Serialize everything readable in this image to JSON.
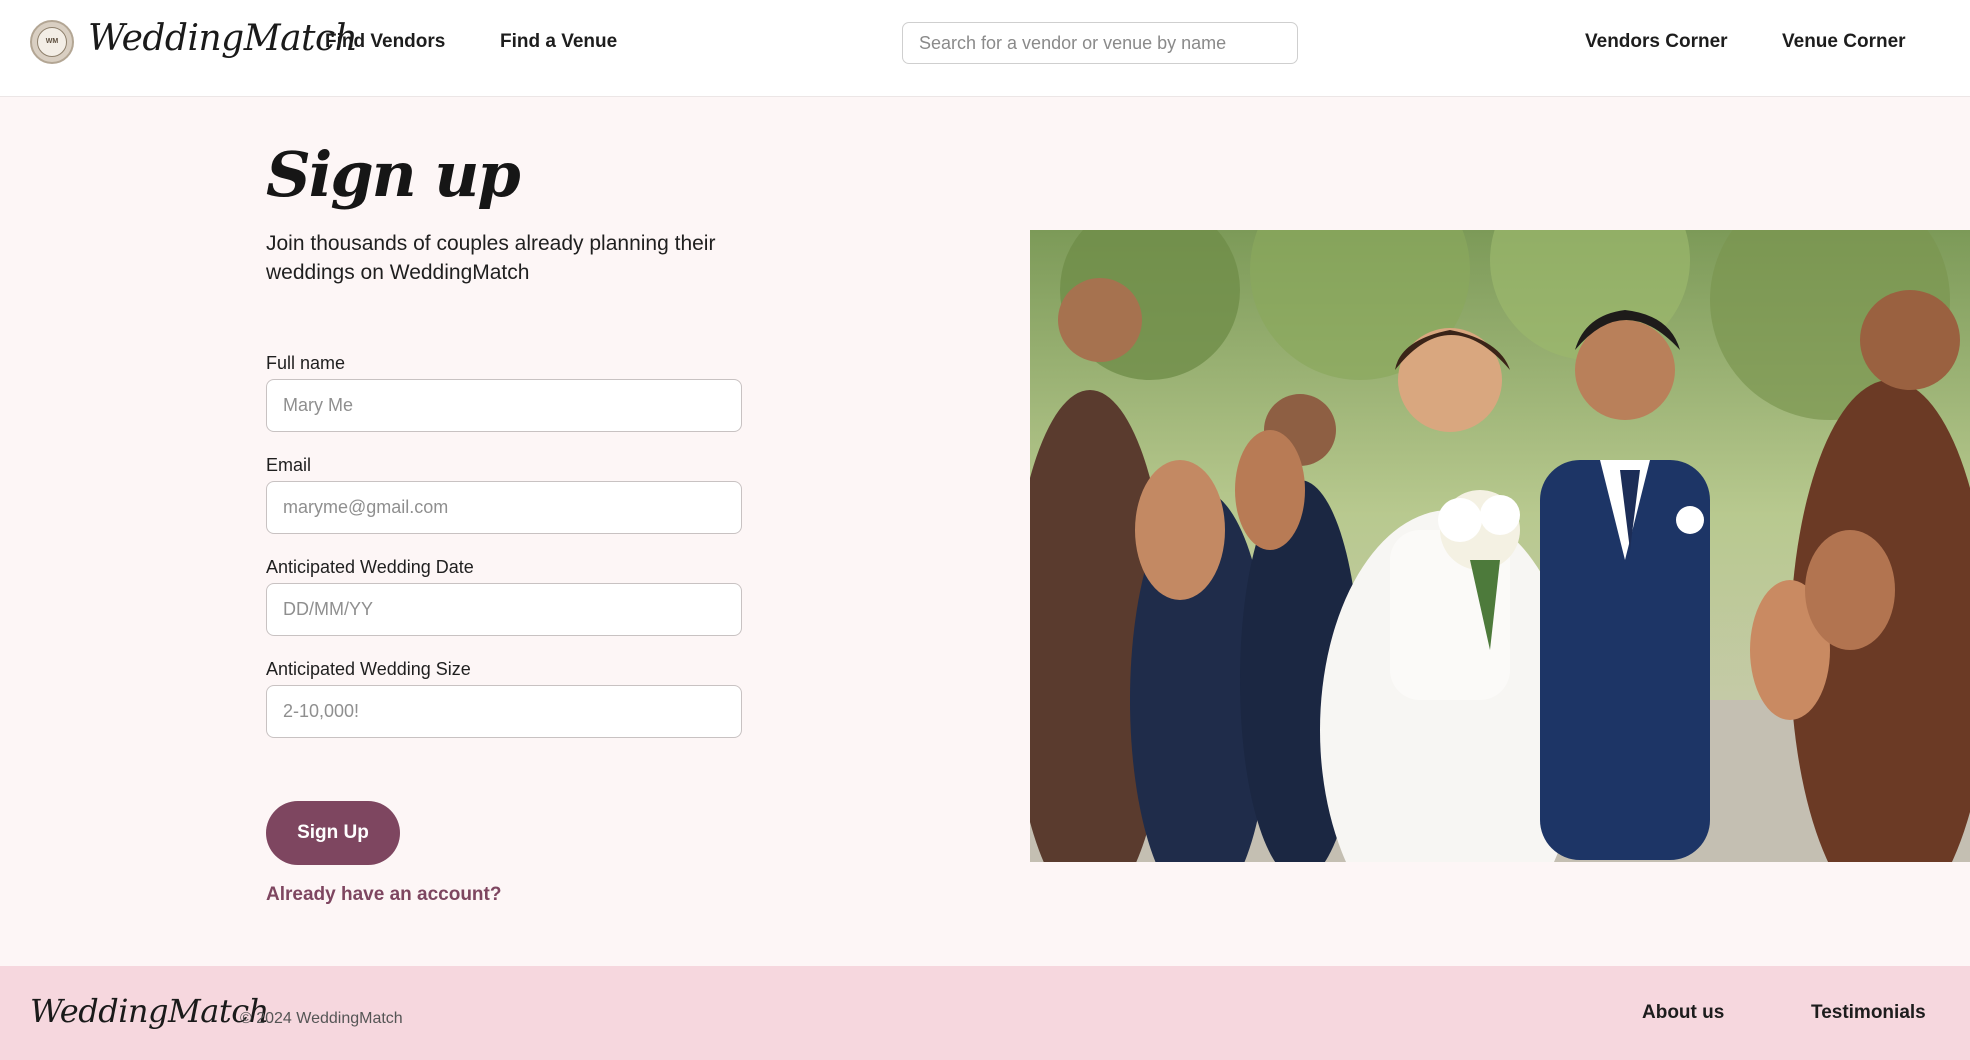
{
  "header": {
    "logo_text": "WeddingMatch",
    "badge_text": "WM",
    "nav": {
      "find_vendors": "Find Vendors",
      "find_venue": "Find a Venue",
      "vendors_corner": "Vendors Corner",
      "venue_corner": "Venue Corner"
    },
    "search": {
      "placeholder": "Search for a vendor or venue by name",
      "icon": "none"
    }
  },
  "signup": {
    "title": "Sign up",
    "intro": "Join thousands of couples already planning their weddings on WeddingMatch",
    "fields": [
      {
        "label": "Full name",
        "placeholder": "Mary Me"
      },
      {
        "label": "Email",
        "placeholder": "maryme@gmail.com"
      },
      {
        "label": "Anticipated Wedding Date",
        "placeholder": "DD/MM/YY"
      },
      {
        "label": "Anticipated Wedding Size",
        "placeholder": "2-10,000!"
      }
    ],
    "button_label": "Sign Up",
    "account_link": "Already have an account?"
  },
  "footer": {
    "logo_text": "WeddingMatch",
    "copyright": "© 2024 WeddingMatch",
    "links": {
      "about": "About us",
      "testimonials": "Testimonials"
    }
  },
  "colors": {
    "accent": "#7e4660",
    "footer_bg": "#f6d7de",
    "page_bg": "#fdf6f6"
  }
}
